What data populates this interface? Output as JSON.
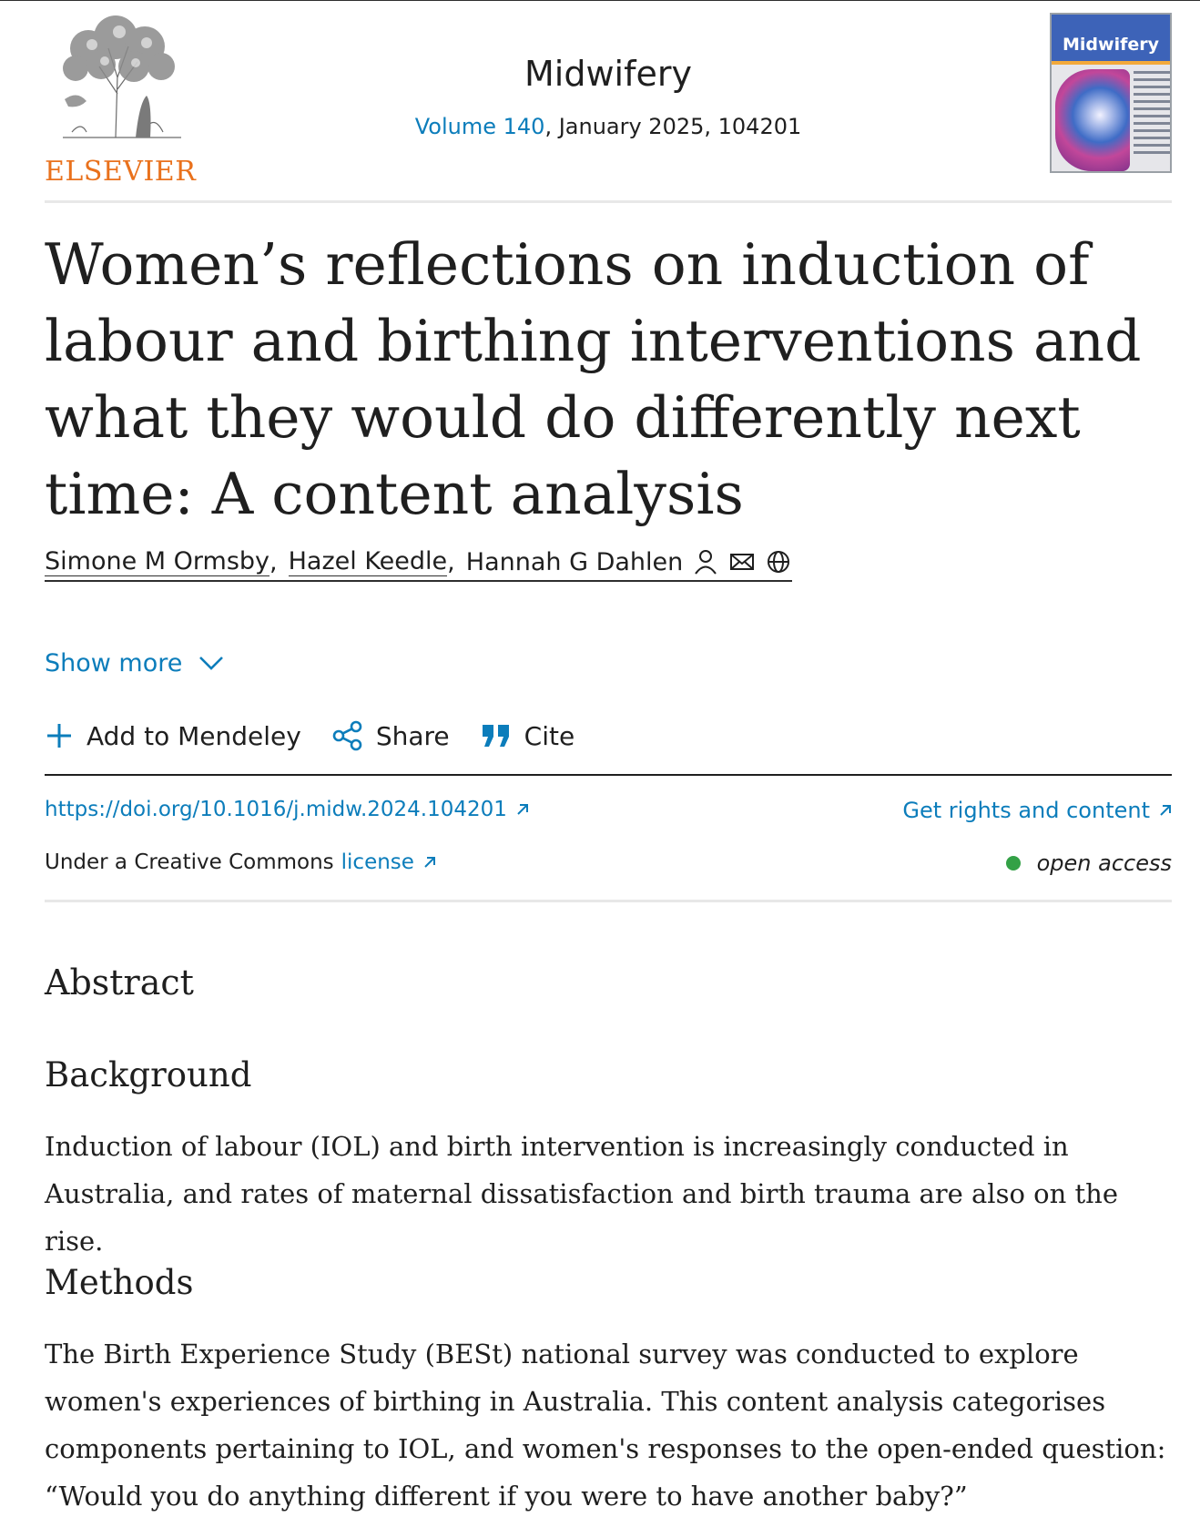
{
  "publisher": {
    "name": "ELSEVIER"
  },
  "journal": {
    "title": "Midwifery",
    "volume_link": "Volume 140",
    "issue_rest": ", January 2025, 104201",
    "cover_title": "Midwifery"
  },
  "article": {
    "title": "Women’s reflections on induction of labour and birthing interventions and what they would do differently next time: A content analysis"
  },
  "authors": [
    {
      "name": "Simone M Ormsby"
    },
    {
      "name": "Hazel Keedle"
    },
    {
      "name": "Hannah G Dahlen"
    }
  ],
  "author_sep": ",",
  "show_more": "Show more",
  "actions": {
    "mendeley": "Add to Mendeley",
    "share": "Share",
    "cite": "Cite"
  },
  "links": {
    "doi": "https://doi.org/10.1016/j.midw.2024.104201",
    "rights": "Get rights and content",
    "license_prefix": "Under a Creative Commons",
    "license_link": "license",
    "open_access": "open access"
  },
  "abstract": {
    "heading": "Abstract",
    "background_heading": "Background",
    "background_text": "Induction of labour (IOL) and birth intervention is increasingly conducted in Australia, and rates of maternal dissatisfaction and birth trauma are also on the rise.",
    "methods_heading": "Methods",
    "methods_text": "The Birth Experience Study (BESt) national survey was conducted to explore women's experiences of birthing in Australia. This content analysis categorises components pertaining to IOL, and women's responses to the open-ended question: “Would you do anything different if you were to have another baby?”"
  },
  "colors": {
    "link": "#0c7dbb",
    "elsevier_orange": "#e9711c",
    "open_access_dot": "#33a146",
    "text": "#1f1f1f"
  },
  "icons": [
    "elsevier-tree-logo",
    "journal-cover",
    "person-icon",
    "mail-icon",
    "globe-icon",
    "chevron-down-icon",
    "plus-icon",
    "share-icon",
    "quote-icon",
    "external-link-icon"
  ]
}
